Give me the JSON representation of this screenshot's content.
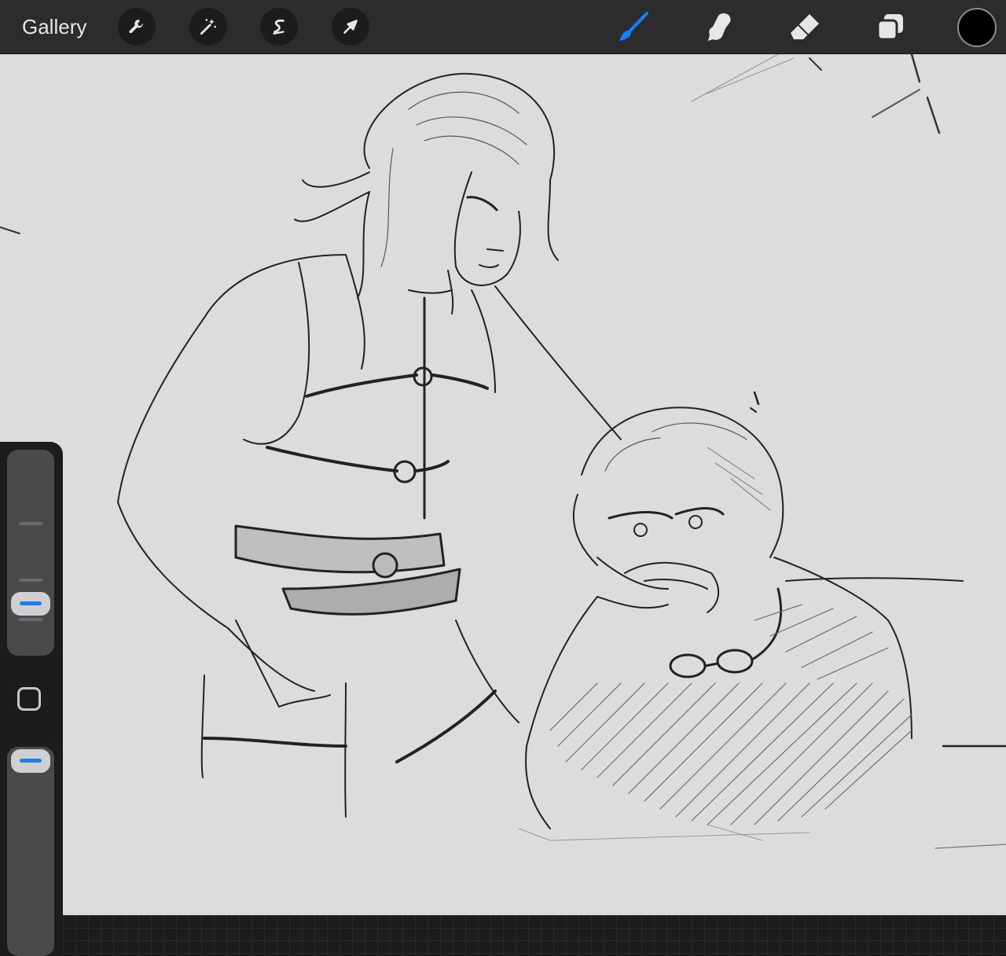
{
  "toolbar": {
    "gallery_label": "Gallery",
    "left_tools": [
      "wrench-icon",
      "magic-wand-icon",
      "selection-s-icon",
      "transform-arrow-icon"
    ],
    "right_tools": [
      "brush-icon",
      "smudge-icon",
      "eraser-icon",
      "layers-icon"
    ],
    "active_tool": "brush",
    "active_color": "#0a84ff",
    "current_color": "#000000"
  },
  "sidebar": {
    "brush_size_level": 0.25,
    "opacity_level": 0.92
  },
  "canvas": {
    "content": "sketch"
  }
}
